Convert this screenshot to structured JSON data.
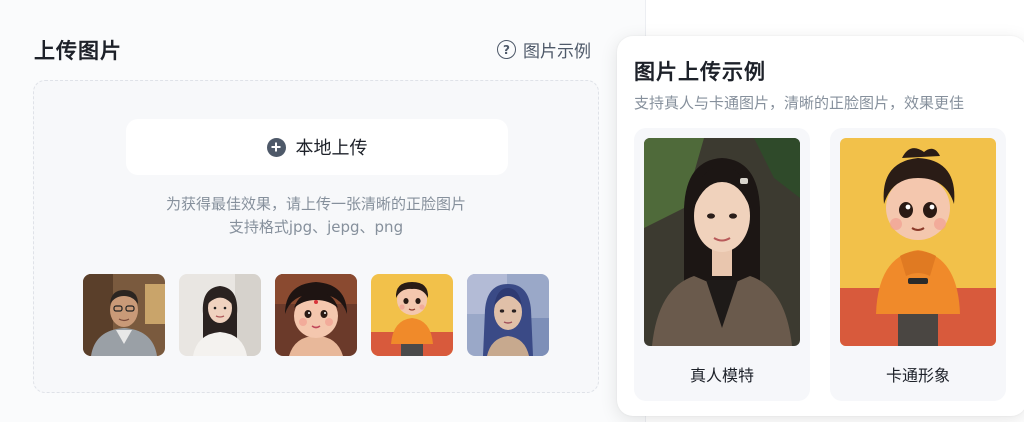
{
  "upload": {
    "title": "上传图片",
    "example_link": "图片示例",
    "upload_button": "本地上传",
    "hint_line1": "为获得最佳效果，请上传一张清晰的正脸图片",
    "hint_line2": "支持格式jpg、jepg、png"
  },
  "samples": [
    {
      "name": "sample-photo-man-glasses"
    },
    {
      "name": "sample-photo-woman-white-shirt"
    },
    {
      "name": "sample-3d-cartoon-girl"
    },
    {
      "name": "sample-3d-cartoon-boy"
    },
    {
      "name": "sample-painted-portrait-woman"
    }
  ],
  "popover": {
    "title": "图片上传示例",
    "subtitle": "支持真人与卡通图片，清晰的正脸图片，效果更佳",
    "cards": [
      {
        "label": "真人模特"
      },
      {
        "label": "卡通形象"
      }
    ]
  },
  "colors": {
    "background": "#fafbfc",
    "upload_zone": "#f7f8fa",
    "text_primary": "#1d2129",
    "text_secondary": "#86909c"
  }
}
